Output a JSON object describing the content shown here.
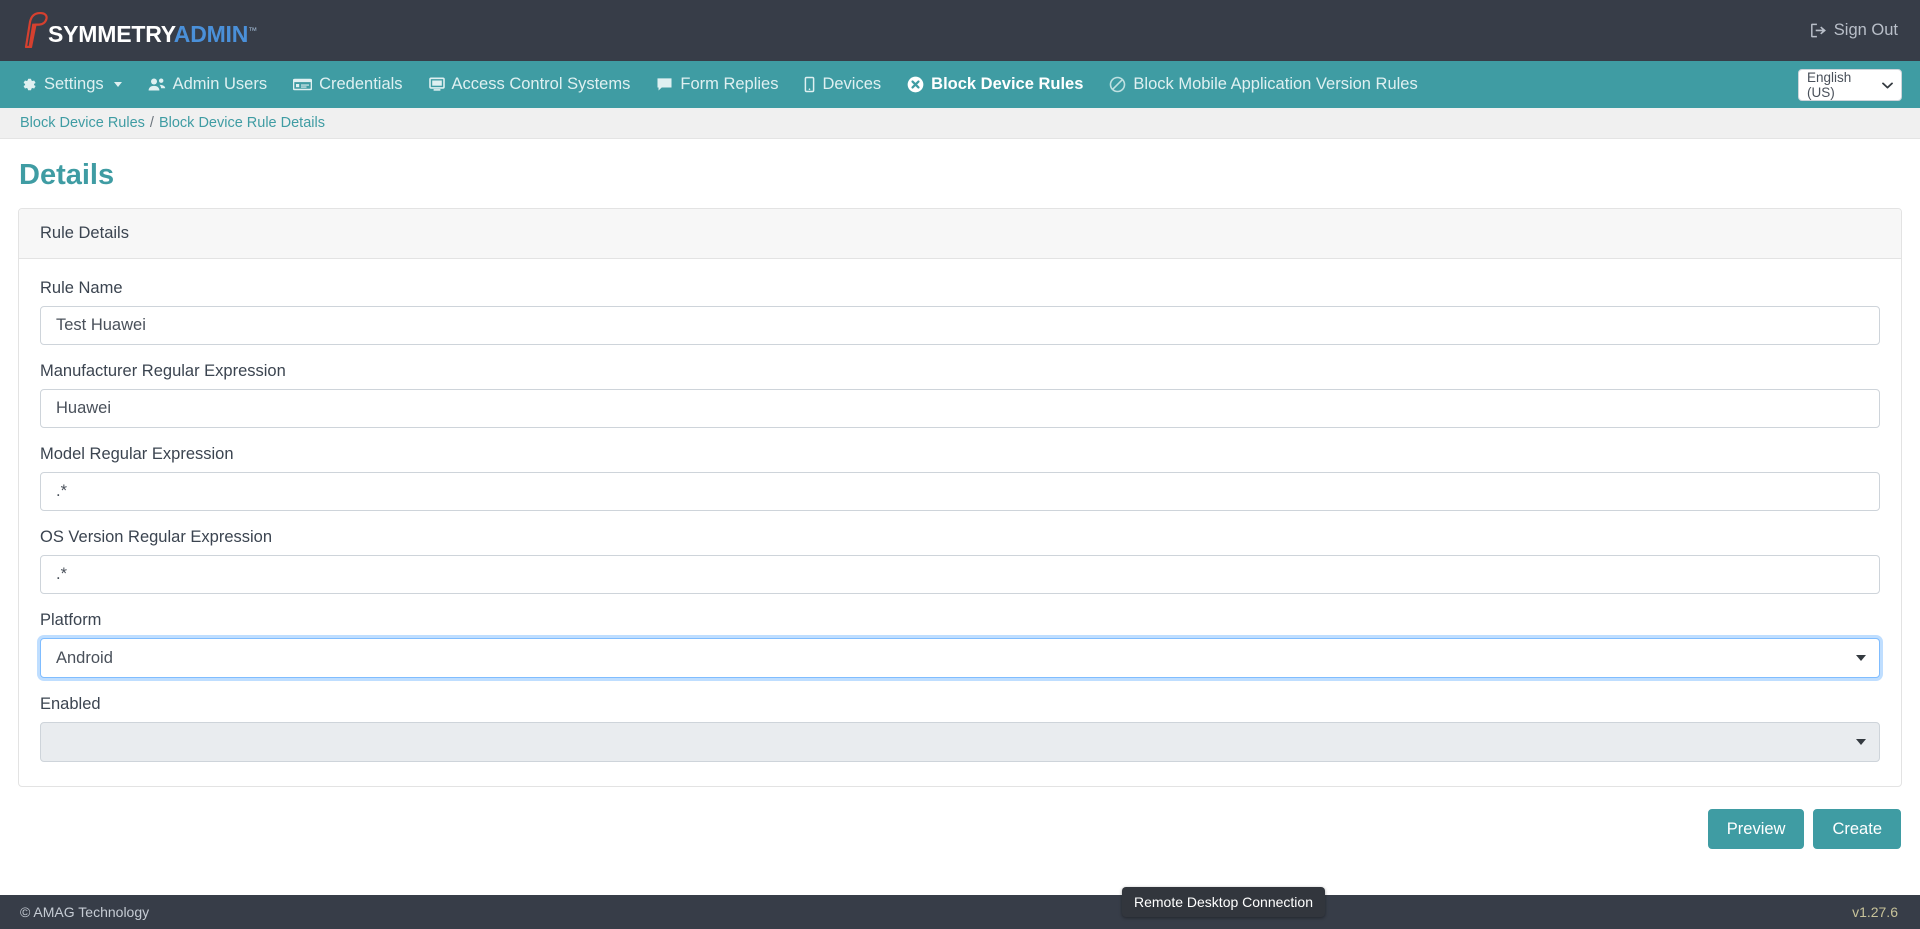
{
  "header": {
    "logo": {
      "icon": "hawk-head-logo-icon",
      "text_primary": "SYMMETRY",
      "text_secondary": "ADMIN",
      "trademark": "™"
    },
    "sign_out": {
      "icon": "sign-out-icon",
      "label": "Sign Out"
    }
  },
  "nav": {
    "items": [
      {
        "label": "Settings",
        "icon": "gear-icon",
        "active": false,
        "has_caret": true
      },
      {
        "label": "Admin Users",
        "icon": "users-icon",
        "active": false,
        "has_caret": false
      },
      {
        "label": "Credentials",
        "icon": "id-card-icon",
        "active": false,
        "has_caret": false
      },
      {
        "label": "Access Control Systems",
        "icon": "desktop-icon",
        "active": false,
        "has_caret": false
      },
      {
        "label": "Form Replies",
        "icon": "comment-icon",
        "active": false,
        "has_caret": false
      },
      {
        "label": "Devices",
        "icon": "mobile-icon",
        "active": false,
        "has_caret": false
      },
      {
        "label": "Block Device Rules",
        "icon": "circle-x-icon",
        "active": true,
        "has_caret": false
      },
      {
        "label": "Block Mobile Application Version Rules",
        "icon": "ban-icon",
        "active": false,
        "has_caret": false
      }
    ],
    "language": {
      "value": "English (US)",
      "chevron": "⌄"
    }
  },
  "breadcrumb": {
    "parent": "Block Device Rules",
    "separator": "/",
    "current": "Block Device Rule Details"
  },
  "page": {
    "title": "Details",
    "card_title": "Rule Details",
    "fields": [
      {
        "label": "Rule Name",
        "value": "Test Huawei",
        "type": "text",
        "state": "normal"
      },
      {
        "label": "Manufacturer Regular Expression",
        "value": "Huawei",
        "type": "text",
        "state": "normal"
      },
      {
        "label": "Model Regular Expression",
        "value": ".*",
        "type": "text",
        "state": "normal"
      },
      {
        "label": "OS Version Regular Expression",
        "value": ".*",
        "type": "text",
        "state": "normal"
      },
      {
        "label": "Platform",
        "value": "Android",
        "type": "select",
        "state": "focused"
      },
      {
        "label": "Enabled",
        "value": "",
        "type": "select",
        "state": "disabled"
      }
    ],
    "buttons": {
      "preview": "Preview",
      "create": "Create"
    }
  },
  "footer": {
    "copyright": "© AMAG Technology",
    "version": "v1.27.6"
  },
  "tooltip": {
    "text": "Remote Desktop Connection"
  },
  "colors": {
    "teal": "#3f9ca3",
    "dark": "#373d48",
    "logo_blue": "#4a90d9",
    "logo_red": "#d6402f",
    "focus_blue": "#80bdff",
    "version_text": "#c8c39a"
  }
}
